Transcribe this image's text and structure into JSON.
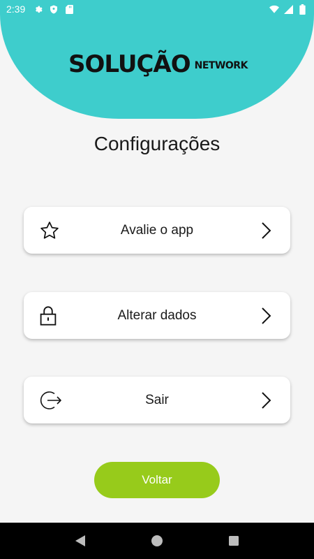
{
  "status_bar": {
    "time": "2:39",
    "left_icons": [
      "gear-icon",
      "shield-icon",
      "sd-card-icon"
    ],
    "right_icons": [
      "wifi-icon",
      "signal-icon",
      "battery-icon"
    ]
  },
  "brand": {
    "logo_main": "SOLUÇÃO",
    "logo_sub": "NETWORK",
    "header_color": "#3ecdcc"
  },
  "page": {
    "title": "Configurações"
  },
  "menu": [
    {
      "label": "Avalie o app",
      "icon": "star-icon"
    },
    {
      "label": "Alterar dados",
      "icon": "lock-icon"
    },
    {
      "label": "Sair",
      "icon": "logout-icon"
    }
  ],
  "actions": {
    "back_label": "Voltar",
    "back_color": "#97cb1b"
  },
  "nav": [
    "back-icon",
    "home-icon",
    "recents-icon"
  ]
}
